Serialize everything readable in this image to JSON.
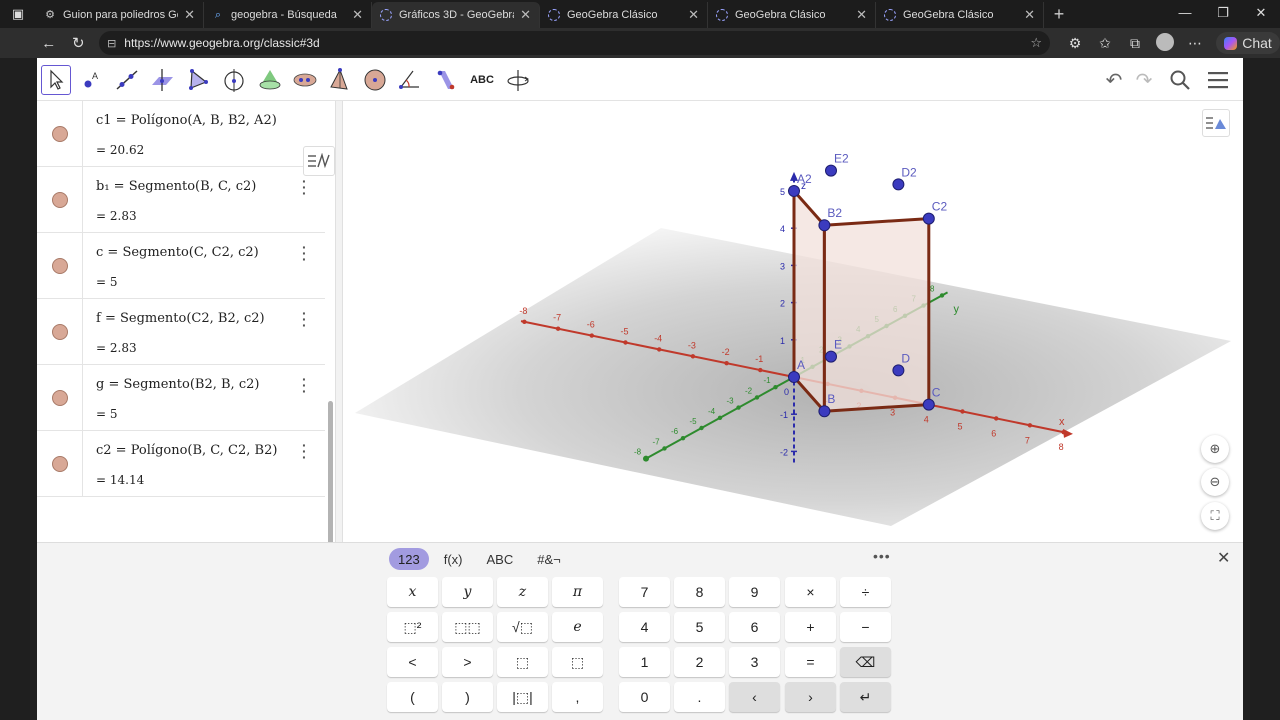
{
  "browser": {
    "tabs": [
      {
        "label": "Guion para poliedros GeoGe",
        "icon": "gear-icon"
      },
      {
        "label": "geogebra - Búsqueda",
        "icon": "search-icon"
      },
      {
        "label": "Gráficos 3D - GeoGebra",
        "icon": "geogebra-icon",
        "active": true
      },
      {
        "label": "GeoGebra Clásico",
        "icon": "geogebra-icon"
      },
      {
        "label": "GeoGebra Clásico",
        "icon": "geogebra-icon"
      },
      {
        "label": "GeoGebra Clásico",
        "icon": "geogebra-icon"
      }
    ],
    "url": "https://www.geogebra.org/classic#3d",
    "chat_label": "Chat"
  },
  "toolbar": {
    "tools": [
      "move-tool",
      "point-tool",
      "line-tool",
      "perpendicular-tool",
      "polygon-tool",
      "circle-axis-tool",
      "intersect-surfaces-tool",
      "pyramid-tool",
      "cone-tool",
      "sphere-tool",
      "angle-tool",
      "reflect-tool",
      "text-tool",
      "rotate-view-tool"
    ],
    "text_tool_label": "ABC"
  },
  "algebra": {
    "rows": [
      {
        "name": "c1",
        "def": "c1  =  Polígono(A, B, B2, A2)",
        "value": "=   20.62"
      },
      {
        "name": "b1",
        "def": "b₁  =  Segmento(B, C, c2)",
        "value": "=   2.83"
      },
      {
        "name": "c",
        "def": "c  =  Segmento(C, C2, c2)",
        "value": "=   5"
      },
      {
        "name": "f",
        "def": "f  =  Segmento(C2, B2, c2)",
        "value": "=   2.83"
      },
      {
        "name": "g",
        "def": "g  =  Segmento(B2, B, c2)",
        "value": "=   5"
      },
      {
        "name": "c2",
        "def": "c2  =  Polígono(B, C, C2, B2)",
        "value": "=   14.14"
      }
    ]
  },
  "view3d": {
    "points": {
      "A2": "A2",
      "E2": "E2",
      "D2": "D2",
      "B2": "B2",
      "C2": "C2",
      "A": "A",
      "B": "B",
      "C": "C",
      "D": "D",
      "E": "E"
    },
    "axis_names": {
      "x": "x",
      "y": "y",
      "z": "z"
    },
    "x_ticks": [
      "-8",
      "-7",
      "-6",
      "-5",
      "-4",
      "-3",
      "-2",
      "-1",
      "1",
      "2",
      "3",
      "4",
      "5",
      "6",
      "7",
      "8"
    ],
    "y_ticks": [
      "-8",
      "-7",
      "-6",
      "-5",
      "-4",
      "-3",
      "-2",
      "-1",
      "1",
      "2",
      "3",
      "4",
      "5",
      "6",
      "7",
      "8"
    ],
    "z_ticks": [
      "5",
      "4",
      "3",
      "2",
      "1",
      "-1",
      "-2"
    ],
    "zero": "0",
    "colors": {
      "x_axis": "#c0392b",
      "y_axis": "#2e8b2e",
      "z_axis": "#2b2bab",
      "polygon_edge": "#7a2a14",
      "polygon_fill": "#f2e0db",
      "point": "#3b3bbf"
    }
  },
  "keyboard": {
    "tabs": [
      "123",
      "f(x)",
      "ABC",
      "#&¬"
    ],
    "more": "•••",
    "left_keys": [
      [
        "x",
        "y",
        "z",
        "π"
      ],
      [
        "⬚²",
        "⬚⬚",
        "√⬚",
        "e"
      ],
      [
        "<",
        ">",
        "⬚",
        "⬚"
      ],
      [
        "(",
        ")",
        "|⬚|",
        ","
      ]
    ],
    "right_keys": [
      [
        "7",
        "8",
        "9",
        "×",
        "÷"
      ],
      [
        "4",
        "5",
        "6",
        "+",
        "−"
      ],
      [
        "1",
        "2",
        "3",
        "=",
        "⌫"
      ],
      [
        "0",
        ".",
        "‹",
        "›",
        "↵"
      ]
    ]
  }
}
